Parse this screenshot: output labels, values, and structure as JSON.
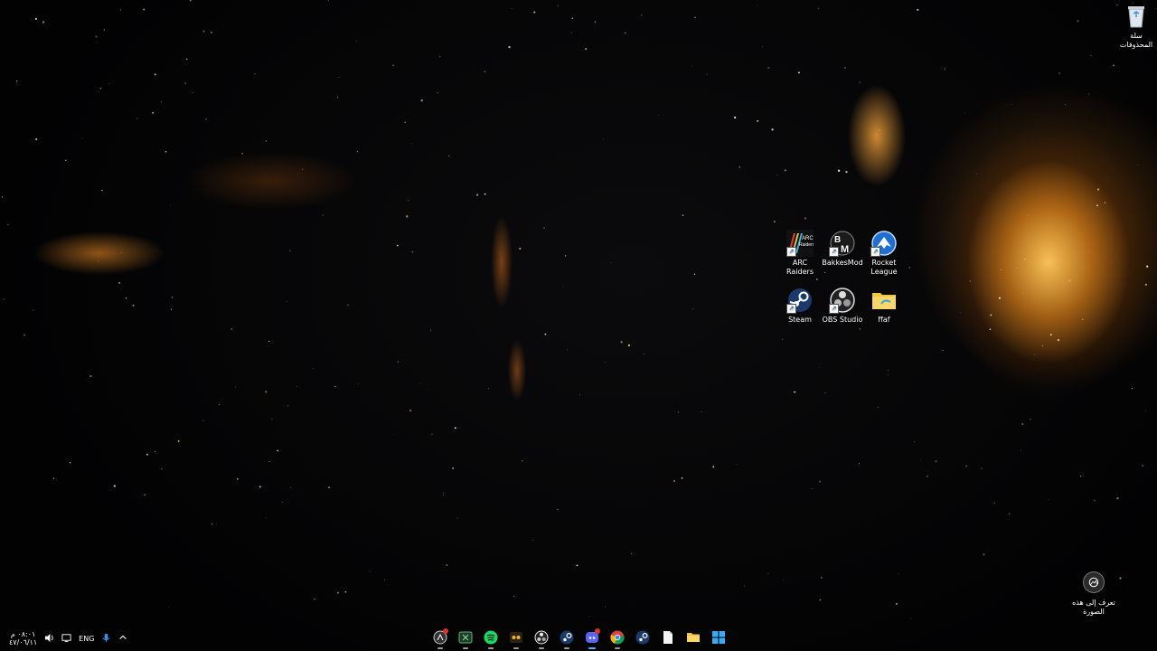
{
  "desktop": {
    "recycle_bin": {
      "label": "سلة المحذوفات",
      "icon": "recycle-bin-icon"
    },
    "icons": [
      {
        "name": "arc-raiders",
        "label": "ARC Raiders",
        "icon": "arc-raiders-icon",
        "shortcut": true
      },
      {
        "name": "bakkesmod",
        "label": "BakkesMod",
        "icon": "bakkesmod-icon",
        "shortcut": true
      },
      {
        "name": "rocket-league",
        "label": "Rocket League",
        "icon": "rocket-league-icon",
        "shortcut": true
      },
      {
        "name": "steam",
        "label": "Steam",
        "icon": "steam-icon",
        "shortcut": true
      },
      {
        "name": "obs-studio",
        "label": "OBS Studio",
        "icon": "obs-icon",
        "shortcut": true
      },
      {
        "name": "ffaf",
        "label": "ffaf",
        "icon": "folder-icon",
        "shortcut": false
      }
    ],
    "learn_about_picture": {
      "label": "تعرف إلى هذه الصورة",
      "icon": "camera-icon"
    }
  },
  "taskbar": {
    "clock": {
      "time": "٠٨:٠١ م",
      "date": "٤٧/٠٦/١١"
    },
    "tray": {
      "language": "ENG",
      "icons": [
        "volume-icon",
        "network-icon",
        "microphone-icon",
        "chevron-up-icon"
      ]
    },
    "apps": [
      {
        "name": "app-1",
        "icon": "circle-app-icon",
        "badge": true,
        "running": true
      },
      {
        "name": "xbox",
        "icon": "xbox-icon",
        "badge": false,
        "running": true
      },
      {
        "name": "spotify",
        "icon": "spotify-icon",
        "badge": false,
        "running": true
      },
      {
        "name": "game-app",
        "icon": "game-app-icon",
        "badge": false,
        "running": true
      },
      {
        "name": "obs",
        "icon": "obs-icon",
        "badge": false,
        "running": true
      },
      {
        "name": "steam",
        "icon": "steam-icon",
        "badge": false,
        "running": true
      },
      {
        "name": "discord",
        "icon": "discord-icon",
        "badge": true,
        "running": true,
        "active": true
      },
      {
        "name": "chrome",
        "icon": "chrome-icon",
        "badge": false,
        "running": true
      },
      {
        "name": "steam-2",
        "icon": "steam-icon",
        "badge": false,
        "running": false
      },
      {
        "name": "notepad",
        "icon": "file-icon",
        "badge": false,
        "running": false
      },
      {
        "name": "file-explorer",
        "icon": "folder-icon",
        "badge": false,
        "running": false
      },
      {
        "name": "start",
        "icon": "windows-icon",
        "badge": false,
        "running": false
      }
    ]
  },
  "colors": {
    "accent": "#ff9a1f",
    "taskbar_active": "#5ab0ff"
  }
}
